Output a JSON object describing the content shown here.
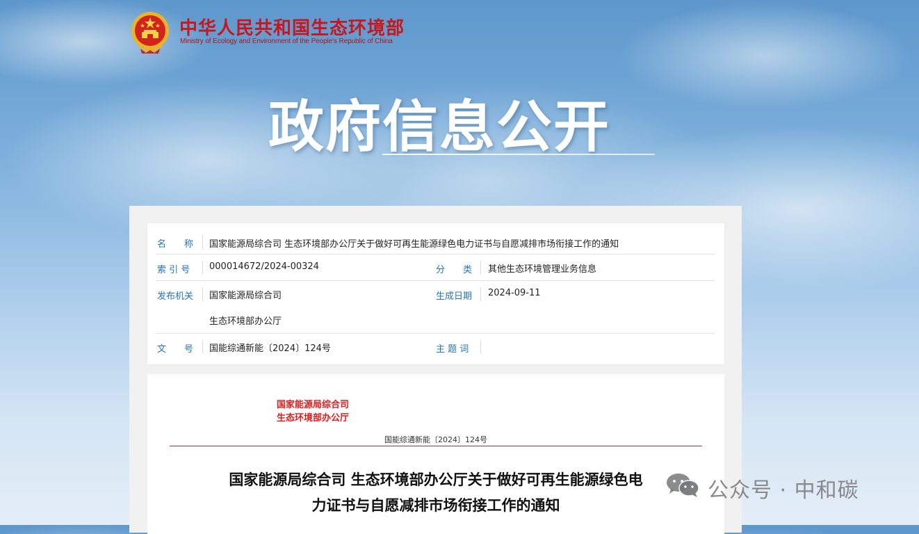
{
  "header": {
    "site_title_cn": "中华人民共和国生态环境部",
    "site_title_en": "Ministry of Ecology and Environment of the People's Republic of China",
    "logo_icon": "national-emblem-icon"
  },
  "banner": {
    "title": "政府信息公开"
  },
  "info_table": {
    "name_label": "名　　称",
    "name_value": "国家能源局综合司 生态环境部办公厅关于做好可再生能源绿色电力证书与自愿减排市场衔接工作的通知",
    "index_label": "索 引 号",
    "index_value": "000014672/2024-00324",
    "category_label": "分　　类",
    "category_value": "其他生态环境管理业务信息",
    "issuer_label": "发布机关",
    "issuer_values": [
      "国家能源局综合司",
      "生态环境部办公厅"
    ],
    "date_label": "生成日期",
    "date_value": "2024-09-11",
    "doc_no_label": "文　　号",
    "doc_no_value": "国能综通新能〔2024〕124号",
    "keywords_label": "主 题 词",
    "keywords_value": ""
  },
  "document": {
    "issuers": [
      "国家能源局综合司",
      "生态环境部办公厅"
    ],
    "doc_number": "国能综通新能〔2024〕124号",
    "title_lines": [
      "国家能源局综合司 生态环境部办公厅关于做好可再生能源绿色电",
      "力证书与自愿减排市场衔接工作的通知"
    ]
  },
  "watermark": {
    "icon": "wechat-icon",
    "text": "公众号 · 中和碳"
  },
  "colors": {
    "brand_red": "#c8161d",
    "label_blue": "#2574b9",
    "issuer_red": "#d81e1e"
  }
}
